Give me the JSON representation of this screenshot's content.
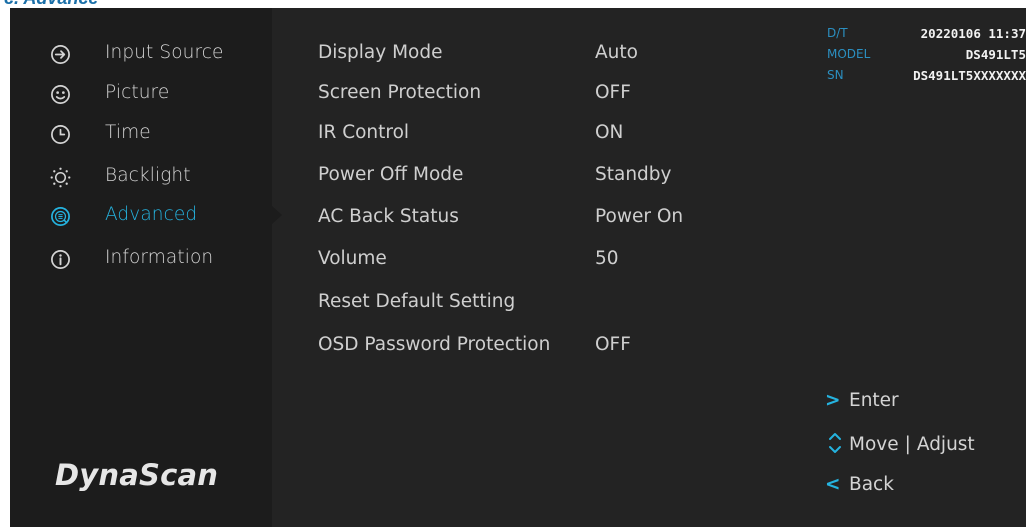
{
  "header": {
    "heading": "c. Advance"
  },
  "sidebar": {
    "items": [
      {
        "label": "Input Source",
        "icon": "input-source-icon"
      },
      {
        "label": "Picture",
        "icon": "picture-icon"
      },
      {
        "label": "Time",
        "icon": "clock-icon"
      },
      {
        "label": "Backlight",
        "icon": "sun-icon"
      },
      {
        "label": "Advanced",
        "icon": "advanced-icon",
        "active": true
      },
      {
        "label": "Information",
        "icon": "info-icon"
      }
    ],
    "logo": "DynaScan"
  },
  "settings": [
    {
      "name": "Display Mode",
      "value": "Auto"
    },
    {
      "name": "Screen Protection",
      "value": "OFF"
    },
    {
      "name": "IR Control",
      "value": "ON"
    },
    {
      "name": "Power Off Mode",
      "value": "Standby"
    },
    {
      "name": "AC Back Status",
      "value": "Power On"
    },
    {
      "name": "Volume",
      "value": "50"
    },
    {
      "name": "Reset Default Setting",
      "value": ""
    },
    {
      "name": "OSD Password Protection",
      "value": "OFF"
    }
  ],
  "device_info": {
    "dt_label": "D/T",
    "dt_value": "20220106 11:37",
    "model_label": "MODEL",
    "model_value": "DS491LT5",
    "sn_label": "SN",
    "sn_value": "DS491LT5XXXXXXX"
  },
  "help": {
    "enter_symbol": ">",
    "enter_label": "Enter",
    "move_label": "Move",
    "separator": "|",
    "adjust_label": "Adjust",
    "back_symbol": "<",
    "back_label": "Back"
  },
  "colors": {
    "accent": "#25b3df",
    "panel_bg": "#232323",
    "sidebar_bg": "#1c1c1c",
    "text": "#d4d4d4",
    "info_label": "#2b8fc0"
  }
}
